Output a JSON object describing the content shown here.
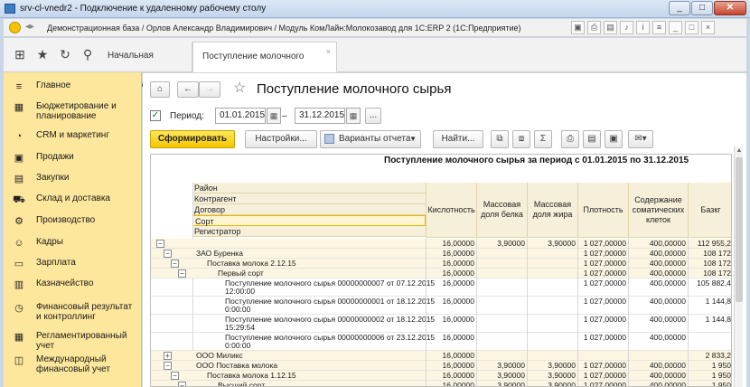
{
  "rdp": {
    "title": "srv-cl-vnedr2 - Подключение к удаленному рабочему столу"
  },
  "app": {
    "title": "Демонстрационная база / Орлов Александр Владимирович / Модуль КомЛайн:Молокозавод для 1С:ERP 2  (1С:Предприятие)"
  },
  "tabs": {
    "home": "Начальная страница",
    "active": "Поступление молочного сырья",
    "close": "×"
  },
  "sidebar": {
    "items": [
      {
        "label": "Главное",
        "icon": "menu-icon"
      },
      {
        "label": "Бюджетирование и планирование",
        "icon": "budget-icon"
      },
      {
        "label": "CRM и маркетинг",
        "icon": "crm-icon"
      },
      {
        "label": "Продажи",
        "icon": "sales-icon"
      },
      {
        "label": "Закупки",
        "icon": "purchases-icon"
      },
      {
        "label": "Склад и доставка",
        "icon": "warehouse-icon"
      },
      {
        "label": "Производство",
        "icon": "production-icon"
      },
      {
        "label": "Кадры",
        "icon": "staff-icon"
      },
      {
        "label": "Зарплата",
        "icon": "salary-icon"
      },
      {
        "label": "Казначейство",
        "icon": "treasury-icon"
      },
      {
        "label": "Финансовый результат и контроллинг",
        "icon": "finance-icon"
      },
      {
        "label": "Регламентированный учет",
        "icon": "accounting-icon"
      },
      {
        "label": "Международный финансовый учет",
        "icon": "intl-finance-icon"
      }
    ]
  },
  "form": {
    "title": "Поступление молочного сырья",
    "period_label": "Период:",
    "period_checked": true,
    "date_from": "01.01.2015",
    "date_to": "31.12.2015",
    "dash": "–",
    "dots": "...",
    "generate": "Сформировать",
    "settings": "Настройки...",
    "variants": "Варианты отчета",
    "find": "Найти..."
  },
  "report": {
    "title": "Поступление молочного сырья за период с 01.01.2015 по 31.12.2015",
    "group_headers": [
      "Район",
      "Контрагент",
      "Договор",
      "Сорт",
      "Регистратор"
    ],
    "selected_group": "Сорт",
    "columns": [
      "Кислотность",
      "Массовая доля белка",
      "Массовая доля жира",
      "Плотность",
      "Содержание соматических клеток",
      "Базкг"
    ],
    "rows": [
      {
        "label": "",
        "level": 0,
        "shade": true,
        "values": [
          "16,00000",
          "3,90000",
          "3,90000",
          "1 027,00000",
          "400,00000",
          "112 955,2"
        ]
      },
      {
        "label": "ЗАО Буренка",
        "level": 1,
        "shade": true,
        "values": [
          "16,00000",
          "",
          "",
          "1 027,00000",
          "400,00000",
          "108 172"
        ]
      },
      {
        "label": "Поставка молока 2.12.15",
        "level": 2,
        "shade": true,
        "values": [
          "16,00000",
          "",
          "",
          "1 027,00000",
          "400,00000",
          "108 172"
        ]
      },
      {
        "label": "Первый сорт",
        "level": 3,
        "shade": true,
        "values": [
          "16,00000",
          "",
          "",
          "1 027,00000",
          "400,00000",
          "108 172"
        ]
      },
      {
        "label": "Поступление молочного сырья 00000000007 от 07.12.2015",
        "label2": "12:00:00",
        "level": 4,
        "shade": false,
        "values": [
          "16,00000",
          "",
          "",
          "1 027,00000",
          "400,00000",
          "105 882,4"
        ]
      },
      {
        "label": "Поступление молочного сырья 00000000001 от 18.12.2015",
        "label2": "0:00:00",
        "level": 4,
        "shade": false,
        "values": [
          "16,00000",
          "",
          "",
          "1 027,00000",
          "400,00000",
          "1 144,8"
        ]
      },
      {
        "label": "Поступление молочного сырья 00000000002 от 18.12.2015",
        "label2": "15:29:54",
        "level": 4,
        "shade": false,
        "values": [
          "16,00000",
          "",
          "",
          "1 027,00000",
          "400,00000",
          "1 144,8"
        ]
      },
      {
        "label": "Поступление молочного сырья 00000000006 от 23.12.2015",
        "label2": "0:00:00",
        "level": 4,
        "shade": false,
        "values": [
          "16,00000",
          "",
          "",
          "1 027,00000",
          "400,00000",
          ""
        ]
      },
      {
        "label": "ООО Миликс",
        "level": 1,
        "shade": true,
        "values": [
          "16,00000",
          "",
          "",
          "",
          "",
          "2 833,2"
        ]
      },
      {
        "label": "ООО Поставка молока",
        "level": 1,
        "shade": true,
        "values": [
          "16,00000",
          "3,90000",
          "3,90000",
          "1 027,00000",
          "400,00000",
          "1 950"
        ]
      },
      {
        "label": "Поставка молока 1.12.15",
        "level": 2,
        "shade": true,
        "values": [
          "16,00000",
          "3,90000",
          "3,90000",
          "1 027,00000",
          "400,00000",
          "1 950"
        ]
      },
      {
        "label": "Высший сорт",
        "level": 3,
        "shade": true,
        "values": [
          "16,00000",
          "3,90000",
          "3,90000",
          "1 027,00000",
          "400,00000",
          "1 950"
        ]
      }
    ]
  }
}
